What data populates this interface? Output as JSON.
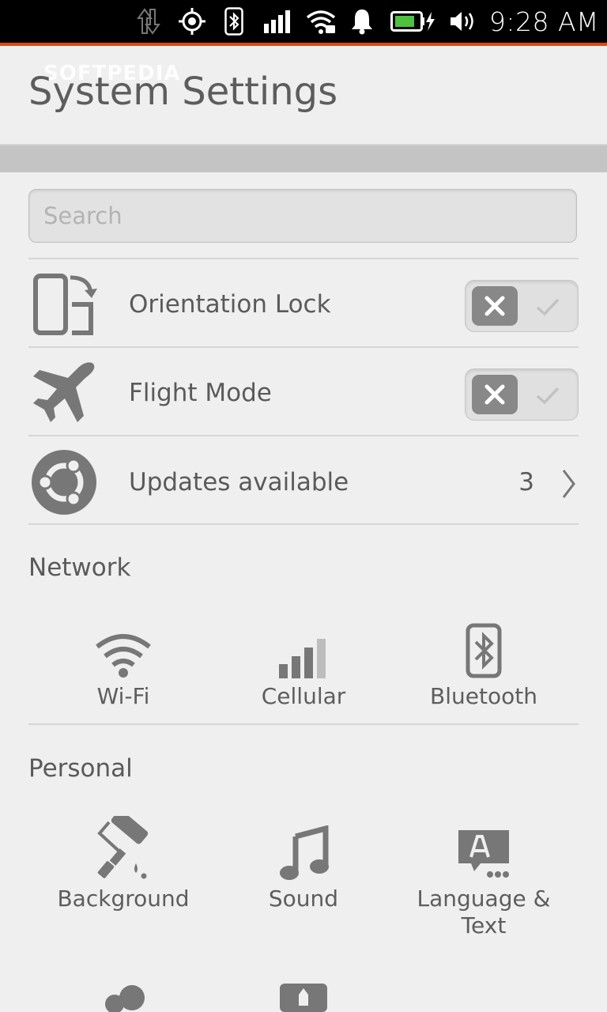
{
  "status_bar": {
    "time": "9:28 AM",
    "icons": [
      "data-transfer-icon",
      "location-icon",
      "bluetooth-icon",
      "signal-icon",
      "wifi-icon",
      "notification-bell-icon",
      "battery-charging-icon",
      "volume-icon"
    ],
    "accent_color": "#dd4814"
  },
  "header": {
    "watermark": "SOFTPEDIA",
    "title": "System Settings"
  },
  "search": {
    "placeholder": "Search",
    "value": ""
  },
  "quick_settings": [
    {
      "label": "Orientation Lock",
      "icon": "orientation-lock-icon",
      "type": "switch",
      "on": false
    },
    {
      "label": "Flight Mode",
      "icon": "airplane-icon",
      "type": "switch",
      "on": false
    },
    {
      "label": "Updates available",
      "icon": "ubuntu-logo-icon",
      "type": "link",
      "count": "3"
    }
  ],
  "sections": [
    {
      "title": "Network",
      "items": [
        {
          "label": "Wi-Fi",
          "icon": "wifi-icon"
        },
        {
          "label": "Cellular",
          "icon": "cellular-icon"
        },
        {
          "label": "Bluetooth",
          "icon": "bluetooth-icon"
        }
      ]
    },
    {
      "title": "Personal",
      "items": [
        {
          "label": "Background",
          "icon": "paint-roller-icon"
        },
        {
          "label": "Sound",
          "icon": "music-note-icon"
        },
        {
          "label": "Language & Text",
          "icon": "language-icon"
        },
        {
          "label": "",
          "icon": "accounts-icon"
        },
        {
          "label": "",
          "icon": "security-icon"
        }
      ]
    }
  ],
  "colors": {
    "background": "#efefef",
    "text": "#5a5a5a",
    "icon": "#777777",
    "switch_knob": "#888888"
  }
}
